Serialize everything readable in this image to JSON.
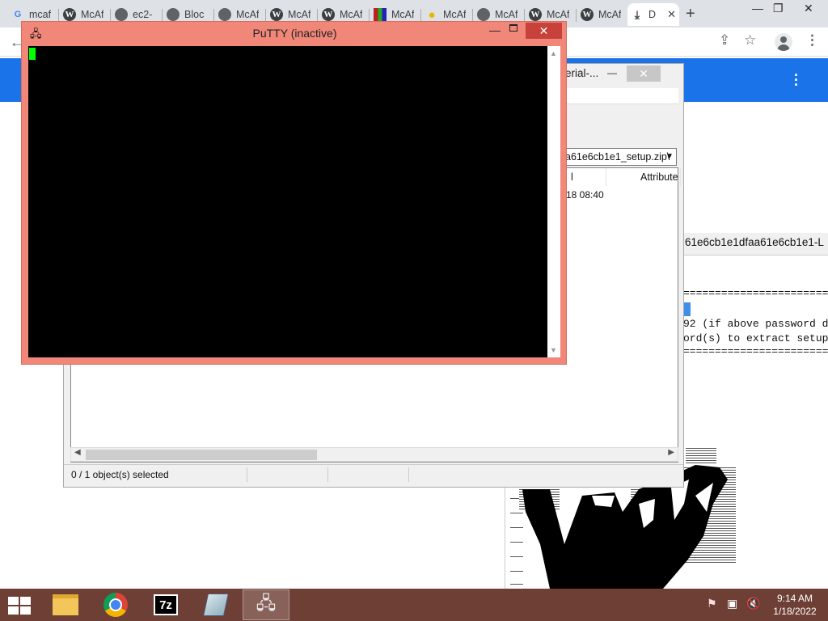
{
  "browser": {
    "tabs": [
      {
        "label": "mcaf",
        "icon": "google-icon"
      },
      {
        "label": "McAf",
        "icon": "wordpress-icon"
      },
      {
        "label": "ec2-",
        "icon": "globe-icon"
      },
      {
        "label": "Bloc",
        "icon": "globe-icon"
      },
      {
        "label": "McAf",
        "icon": "globe-icon"
      },
      {
        "label": "McAf",
        "icon": "wordpress-icon"
      },
      {
        "label": "McAf",
        "icon": "wordpress-icon"
      },
      {
        "label": "McAf",
        "icon": "winrar-icon"
      },
      {
        "label": "McAf",
        "icon": "duck-icon"
      },
      {
        "label": "McAf",
        "icon": "globe-icon"
      },
      {
        "label": "McAf",
        "icon": "wordpress-icon"
      },
      {
        "label": "McAf",
        "icon": "wordpress-icon"
      },
      {
        "label": "D",
        "icon": "download-icon"
      }
    ],
    "new_tab": "+",
    "accent": "#1a73e8"
  },
  "putty": {
    "title": "PuTTY (inactive)",
    "cursor_color": "#00ff00",
    "frame_color": "#f08779"
  },
  "sevenzip": {
    "title_fragment": "erial-...",
    "address": "a61e6cb1e1_setup.zip\\",
    "columns": [
      "l",
      "Attribute"
    ],
    "row_date": "18 08:40",
    "status": "0 / 1 object(s) selected"
  },
  "console": {
    "title_fragment": "61e6cb1e1dfaa61e6cb1e1-L",
    "lines": [
      "=============================",
      "",
      "92 (if above password d",
      "ord(s) to extract setup",
      "============================="
    ]
  },
  "taskbar": {
    "items": [
      "file-explorer",
      "chrome",
      "7-zip",
      "notepad",
      "putty"
    ],
    "time": "9:14 AM",
    "date": "1/18/2022",
    "color": "#6e4035"
  }
}
